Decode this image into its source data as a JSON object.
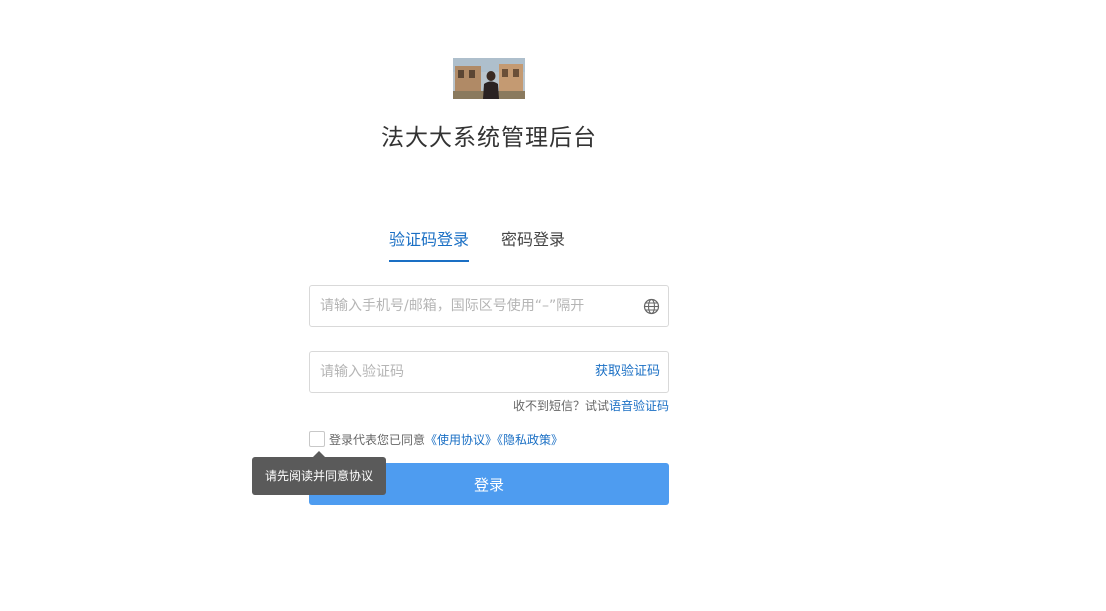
{
  "header": {
    "title": "法大大系统管理后台",
    "logo_icon": "avatar-photo"
  },
  "tabs": [
    {
      "label": "验证码登录",
      "active": true
    },
    {
      "label": "密码登录",
      "active": false
    }
  ],
  "account_field": {
    "placeholder": "请输入手机号/邮箱，国际区号使用“–”隔开",
    "value": "",
    "icon": "globe-icon"
  },
  "code_field": {
    "placeholder": "请输入验证码",
    "value": "",
    "get_code_label": "获取验证码"
  },
  "sms_hint": {
    "text": "收不到短信？试试",
    "link": "语音验证码"
  },
  "agreement": {
    "checked": false,
    "text": "登录代表您已同意",
    "terms_link": "《使用协议》",
    "privacy_link": "《隐私政策》"
  },
  "login_button": {
    "label": "登录"
  },
  "tooltip": {
    "text": "请先阅读并同意协议"
  },
  "colors": {
    "accent": "#1a6fc4",
    "button": "#4e9cf0",
    "tooltip_bg": "#5a5a5a"
  }
}
